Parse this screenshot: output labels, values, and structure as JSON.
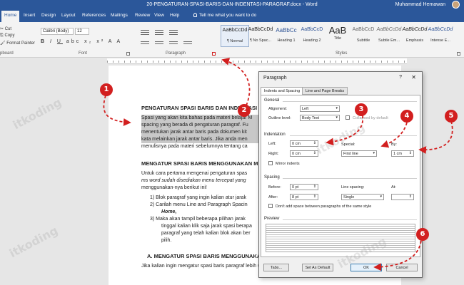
{
  "window": {
    "title": "20-PENGATURAN-SPASI-BARIS-DAN-INDENTASI-PARAGRAF.docx  -  Word",
    "user": "Muhammad Hemawan"
  },
  "tabs": [
    "Home",
    "Insert",
    "Design",
    "Layout",
    "References",
    "Mailings",
    "Review",
    "View",
    "Help"
  ],
  "tell_me": "Tell me what you want to do",
  "clipboard": {
    "cut": "Cut",
    "copy": "Copy",
    "format_painter": "Format Painter",
    "label": "pboard"
  },
  "font": {
    "name": "Calibri (Body)",
    "size": "12",
    "label": "Font"
  },
  "paragraph_label": "Paragraph",
  "styles": {
    "label": "Styles",
    "items": [
      {
        "preview": "AaBbCcDd",
        "name": "¶ Normal"
      },
      {
        "preview": "AaBbCcDd",
        "name": "¶ No Spac..."
      },
      {
        "preview": "AaBbCc",
        "name": "Heading 1"
      },
      {
        "preview": "AaBbCcD",
        "name": "Heading 2"
      },
      {
        "preview": "AaB",
        "name": "Title"
      },
      {
        "preview": "AaBbCcD",
        "name": "Subtitle"
      },
      {
        "preview": "AaBbCcDd",
        "name": "Subtle Em..."
      },
      {
        "preview": "AaBbCcDd",
        "name": "Emphasis"
      },
      {
        "preview": "AaBbCcDd",
        "name": "Intense E..."
      }
    ]
  },
  "document": {
    "heading1": "PENGATURAN SPASI BARIS DAN INDENTASI",
    "sel1": "Spasi yang akan kita bahas pada materi belajar M",
    "sel2": "spacing yang berada di pengaturan paragraf. Fu",
    "sel3": "menentukan jarak antar baris pada dokumen kit",
    "sel4": "kata melainkan jarak antar baris. Jika anda men",
    "line5": "menulisnya pada materi sebelumnya tentang ca",
    "heading2": "MENGATUR SPASI BARIS MENGGUNAKAN MEN",
    "p1": "Untuk cara pertama mengenai pengaturan spas",
    "p2": "ms word sudah disediakan menu tercepat yang",
    "p3": "menggunakan-nya berikut ini!",
    "l1": "1)   Blok paragraf yang ingin kalian atur jarak",
    "l2": "2)   Carilah menu Line and Paragraph Spacin",
    "l2b": "Home,",
    "l3": "3)   Maka akan tampil beberapa pilihan jarak",
    "l3b": "tinggal kalian klik saja jarak spasi berapa",
    "l3c": "paragraf yang telah kalian blok akan ber",
    "l3d": "pilih.",
    "heading3": "A.   MENGATUR SPASI BARIS MENGGUNAKA",
    "last": "Jika kalian ingin mengatur spasi baris paragraf lebih spesifik lagi kalian bisa memanfaatkan"
  },
  "dialog": {
    "title": "Paragraph",
    "help": "?",
    "close": "✕",
    "tab_indents": "Indents and Spacing",
    "tab_breaks": "Line and Page Breaks",
    "general": "General",
    "alignment_label": "Alignment:",
    "alignment_value": "Left",
    "outline_label": "Outline level:",
    "outline_value": "Body Text",
    "collapsed": "Collapsed by default",
    "indentation": "Indentation",
    "left_label": "Left:",
    "left_value": "0 cm",
    "right_label": "Right:",
    "right_value": "0 cm",
    "special_label": "Special:",
    "special_value": "First line",
    "by_label": "By:",
    "by_value": "1 cm",
    "mirror": "Mirror indents",
    "spacing": "Spacing",
    "before_label": "Before:",
    "before_value": "0 pt",
    "after_label": "After:",
    "after_value": "8 pt",
    "line_spacing_label": "Line spacing:",
    "line_spacing_value": "Single",
    "at_label": "At:",
    "dont_add": "Don't add space between paragraphs of the same style",
    "preview": "Preview",
    "tabs_btn": "Tabs...",
    "default_btn": "Set As Default",
    "ok_btn": "OK",
    "cancel_btn": "Cancel"
  },
  "markers": [
    "1",
    "2",
    "3",
    "4",
    "5",
    "6"
  ],
  "watermark": "itkoding",
  "colors": {
    "word_blue": "#2b579a",
    "annotation_red": "#d21f1f"
  }
}
